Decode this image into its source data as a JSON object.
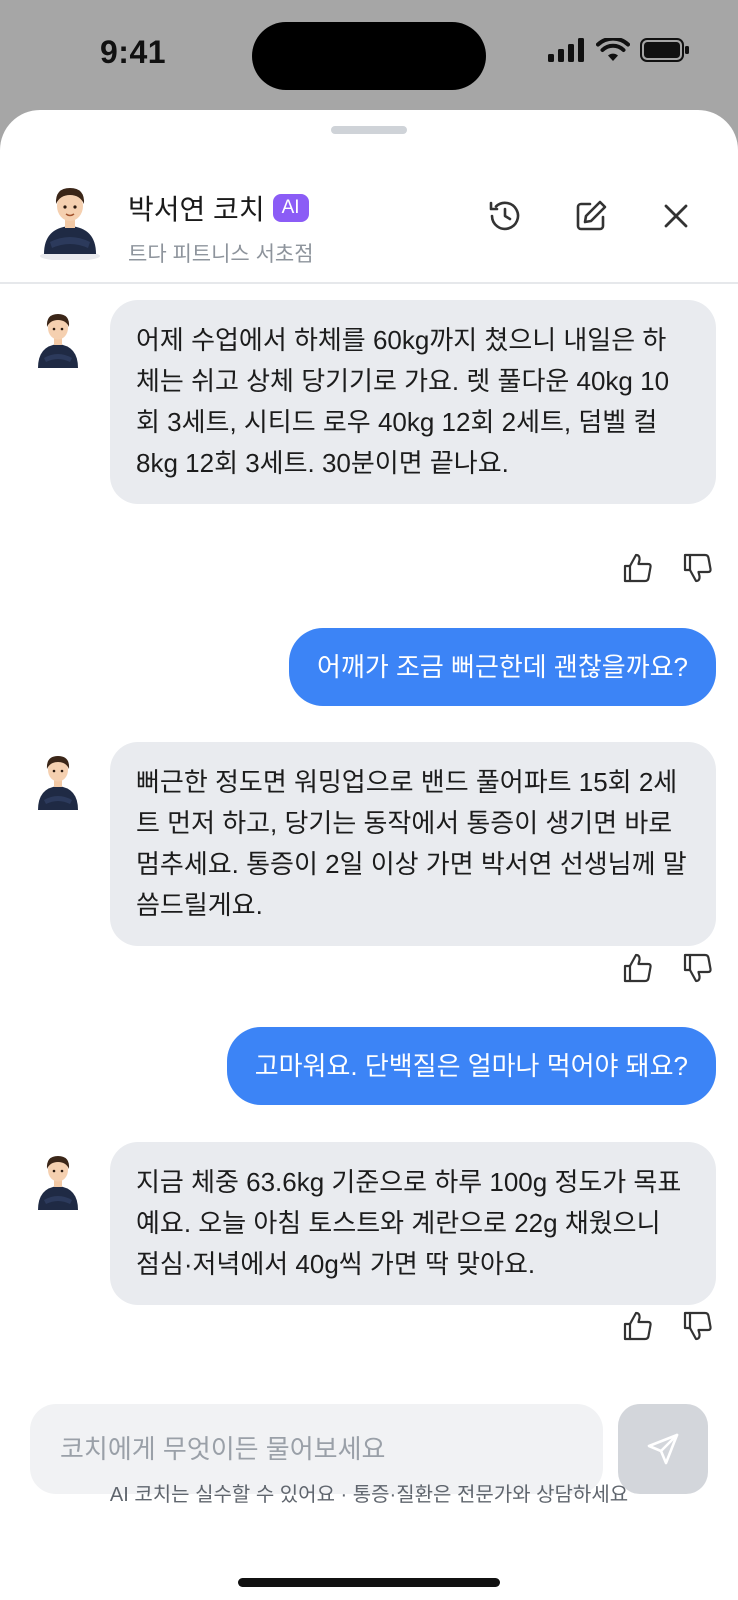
{
  "status_bar": {
    "time": "9:41"
  },
  "header": {
    "coach_name": "박서연 코치",
    "badge": "AI",
    "gym": "트다 피트니스 서초점",
    "icons": [
      "history-icon",
      "compose-icon",
      "close-icon"
    ]
  },
  "messages": [
    {
      "role": "coach",
      "text": "어제 수업에서 하체를 60kg까지 쳤으니 내일은 하체는 쉬고 상체 당기기로 가요. 렛 풀다운 40kg 10회 3세트, 시티드 로우 40kg 12회 2세트, 덤벨 컬 8kg 12회 3세트. 30분이면 끝나요."
    },
    {
      "role": "user",
      "text": "어깨가 조금 뻐근한데 괜찮을까요?"
    },
    {
      "role": "coach",
      "text": "뻐근한 정도면 워밍업으로 밴드 풀어파트 15회 2세트 먼저 하고, 당기는 동작에서 통증이 생기면 바로 멈추세요. 통증이 2일 이상 가면 박서연 선생님께 말씀드릴게요."
    },
    {
      "role": "user",
      "text": "고마워요. 단백질은 얼마나 먹어야 돼요?"
    },
    {
      "role": "coach",
      "text": "지금 체중 63.6kg 기준으로 하루 100g 정도가 목표예요. 오늘 아침 토스트와 계란으로 22g 채웠으니 점심·저녁에서 40g씩 가면 딱 맞아요."
    }
  ],
  "composer": {
    "placeholder": "코치에게 무엇이든 물어보세요",
    "value": ""
  },
  "disclaimer": "AI 코치는 실수할 수 있어요 · 통증·질환은 전문가와 상담하세요",
  "colors": {
    "user_bubble": "#3c84f6",
    "coach_bubble": "#e9ebef",
    "ai_badge": "#8b5cf6",
    "send_button": "#d3d6db"
  }
}
